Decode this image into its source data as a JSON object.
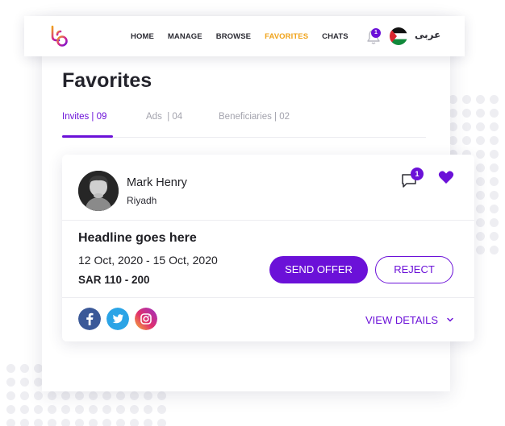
{
  "nav": {
    "links": [
      "HOME",
      "MANAGE",
      "BROWSE",
      "FAVORITES",
      "CHATS"
    ],
    "active": "FAVORITES",
    "notification_count": "1",
    "language_label": "عربى"
  },
  "page": {
    "title": "Favorites"
  },
  "tabs": [
    {
      "label": "Invites | 09"
    },
    {
      "label": "Ads  | 04"
    },
    {
      "label": "Beneficiaries | 02"
    }
  ],
  "invite": {
    "user_name": "Mark Henry",
    "user_city": "Riyadh",
    "chat_count": "1",
    "headline": "Headline goes here",
    "dates": "12 Oct, 2020 - 15 Oct, 2020",
    "price": "SAR 110 - 200",
    "send_offer_label": "SEND OFFER",
    "reject_label": "REJECT",
    "view_details_label": "VIEW DETAILS"
  },
  "colors": {
    "accent": "#6b11d8",
    "active_nav": "#f0a31a"
  },
  "icons": [
    "logo-icon",
    "bell-icon",
    "flag-icon",
    "chat-icon",
    "heart-icon",
    "facebook-icon",
    "twitter-icon",
    "instagram-icon",
    "chevron-down-icon"
  ]
}
